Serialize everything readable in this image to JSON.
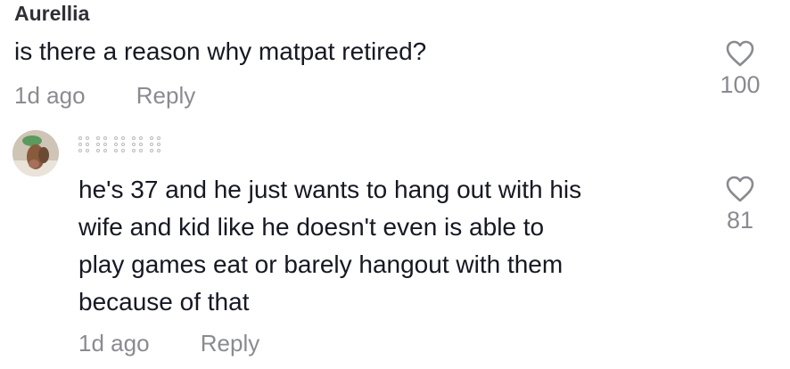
{
  "comment1": {
    "username": "Aurellia",
    "text": "is there a reason why matpat retired?",
    "time": "1d ago",
    "reply_label": "Reply",
    "likes": "100"
  },
  "comment2": {
    "text_lines": [
      "he's 37 and he just wants to hang out with his",
      "wife and kid like he doesn't even is able to",
      "play games eat or barely hangout with them",
      "because of that"
    ],
    "time": "1d ago",
    "reply_label": "Reply",
    "likes": "81"
  },
  "icons": {
    "like": "heart-outline-icon"
  },
  "colors": {
    "text": "#161823",
    "muted": "#8a8b91",
    "username": "#2f2f35"
  }
}
